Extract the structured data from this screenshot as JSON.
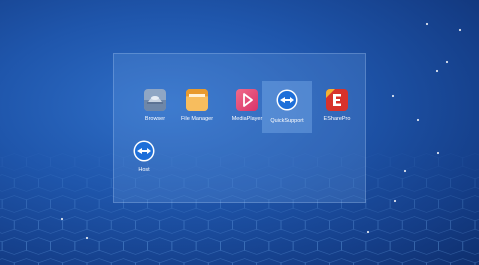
{
  "desktop": {
    "background": "blue-hexagon-wallpaper"
  },
  "apps": [
    {
      "label": "Browser",
      "icon": "browser-icon"
    },
    {
      "label": "File Manager",
      "icon": "folder-icon"
    },
    {
      "label": "MediaPlayer",
      "icon": "play-icon"
    },
    {
      "label": "QuickSupport",
      "icon": "quicksupport-icon",
      "selected": true
    },
    {
      "label": "ESharePro",
      "icon": "eshare-icon"
    },
    {
      "label": "Host",
      "icon": "host-icon"
    }
  ],
  "colors": {
    "accent": "#1f56ac",
    "media_player": "#e8457a",
    "file_manager": "#f0a23c",
    "eshare": "#d8322b",
    "quicksupport": "#1e6fd9"
  }
}
